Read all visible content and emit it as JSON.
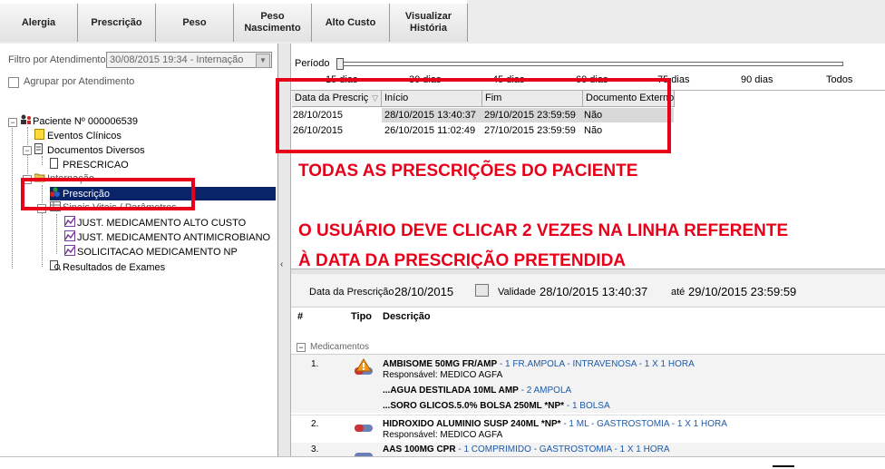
{
  "toolbar": {
    "buttons": [
      "Alergia",
      "Prescrição",
      "Peso",
      "Peso\nNascimento",
      "Alto Custo",
      "Visualizar\nHistória"
    ]
  },
  "filter": {
    "label": "Filtro por Atendimento:",
    "value": "30/08/2015 19:34 - Internação",
    "group_label": "Agrupar por Atendimento"
  },
  "tree": {
    "patient": "Paciente Nº 000006539",
    "items": [
      "Eventos Clínicos",
      "Documentos Diversos",
      "PRESCRICAO",
      "Internação",
      "Prescrição",
      "Sinais Vitais / Parâmetros",
      "JUST. MEDICAMENTO ALTO CUSTO",
      "JUST. MEDICAMENTO ANTIMICROBIANO",
      "SOLICITACAO MEDICAMENTO NP",
      "Resultados de Exames"
    ]
  },
  "period": {
    "label": "Período",
    "ticks": [
      "15 dias",
      "30 dias",
      "45 dias",
      "60 dias",
      "75 dias",
      "90 dias",
      "Todos"
    ]
  },
  "grid": {
    "headers": [
      "Data da Prescriç",
      "Início",
      "Fim",
      "Documento Externo"
    ],
    "rows": [
      [
        "28/10/2015",
        "28/10/2015 13:40:37",
        "29/10/2015 23:59:59",
        "Não"
      ],
      [
        "26/10/2015",
        "26/10/2015 11:02:49",
        "27/10/2015 23:59:59",
        "Não"
      ]
    ]
  },
  "annotations": {
    "line1": "TODAS AS PRESCRIÇÕES DO PACIENTE",
    "line2": "O USUÁRIO DEVE CLICAR 2 VEZES NA LINHA REFERENTE",
    "line3": " À DATA DA PRESCRIÇÃO PRETENDIDA"
  },
  "detail": {
    "date_label": "Data da Prescrição",
    "date_value": "28/10/2015",
    "validity_label": "Validade",
    "validity_start": "28/10/2015 13:40:37",
    "until_label": "até",
    "validity_end": "29/10/2015 23:59:59",
    "columns": [
      "#",
      "Tipo",
      "Descrição"
    ],
    "section": "Medicamentos",
    "meds": [
      {
        "num": "1.",
        "name": "AMBISOME 50MG FR/AMP",
        "detail": "- 1 FR.AMPOLA - INTRAVENOSA - 1 X 1 HORA",
        "resp": "Responsável: MEDICO AGFA",
        "subs": [
          {
            "name": "...AGUA DESTILADA 10ML AMP",
            "detail": "- 2 AMPOLA"
          },
          {
            "name": "...SORO GLICOS.5.0% BOLSA 250ML *NP*",
            "detail": "- 1 BOLSA"
          }
        ]
      },
      {
        "num": "2.",
        "name": "HIDROXIDO ALUMINIO SUSP 240ML *NP*",
        "detail": "- 1 ML - GASTROSTOMIA - 1 X 1 HORA",
        "resp": "Responsável: MEDICO AGFA"
      },
      {
        "num": "3.",
        "name": "AAS 100MG CPR",
        "detail": "- 1 COMPRIMIDO - GASTROSTOMIA - 1 X 1 HORA"
      }
    ]
  },
  "colors": {
    "annotation_red": "#e8001a",
    "selection_blue": "#0a246a",
    "link_blue": "#1c5aa8"
  }
}
